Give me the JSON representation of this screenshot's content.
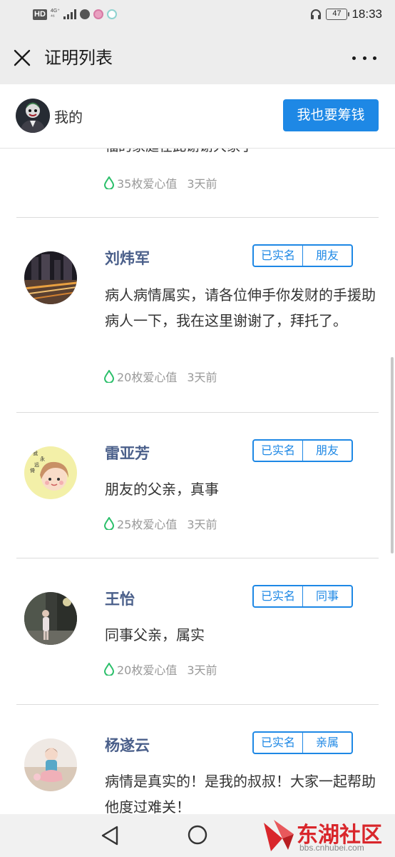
{
  "status_bar": {
    "network_badge": "HD",
    "network_type": "4G⁺",
    "network_sub": "⁴⁶",
    "battery_level": "47",
    "time": "18:33"
  },
  "title_bar": {
    "title": "证明列表"
  },
  "mine": {
    "label": "我的",
    "raise_button": "我也要筹钱"
  },
  "feed": {
    "partial_entry": {
      "text": "福的家庭在此谢谢大家了",
      "love": "35枚爱心值",
      "ago": "3天前"
    },
    "entries": [
      {
        "name": "刘炜军",
        "tag_verified": "已实名",
        "tag_relation": "朋友",
        "comment": "病人病情属实，请各位伸手你发财的手援助病人一下，我在这里谢谢了，拜托了。",
        "love": "20枚爱心值",
        "ago": "3天前"
      },
      {
        "name": "雷亚芳",
        "tag_verified": "已实名",
        "tag_relation": "朋友",
        "comment": "朋友的父亲，真事",
        "love": "25枚爱心值",
        "ago": "3天前",
        "avatar_text": "我永远倚"
      },
      {
        "name": "王怡",
        "tag_verified": "已实名",
        "tag_relation": "同事",
        "comment": "同事父亲，属实",
        "love": "20枚爱心值",
        "ago": "3天前"
      },
      {
        "name": "杨遂云",
        "tag_verified": "已实名",
        "tag_relation": "亲属",
        "comment": "病情是真实的！是我的叔叔！大家一起帮助他度过难关！"
      }
    ]
  },
  "watermark": {
    "name": "东湖社区",
    "url": "bbs.cnhubei.com"
  },
  "colors": {
    "accent": "#1e88e5",
    "name_color": "#4a5f8a",
    "heart_green": "#2bbf6a",
    "watermark_red": "#d9262b"
  },
  "icons": [
    "close-icon",
    "more-icon",
    "drop-icon",
    "back-icon",
    "home-icon"
  ]
}
